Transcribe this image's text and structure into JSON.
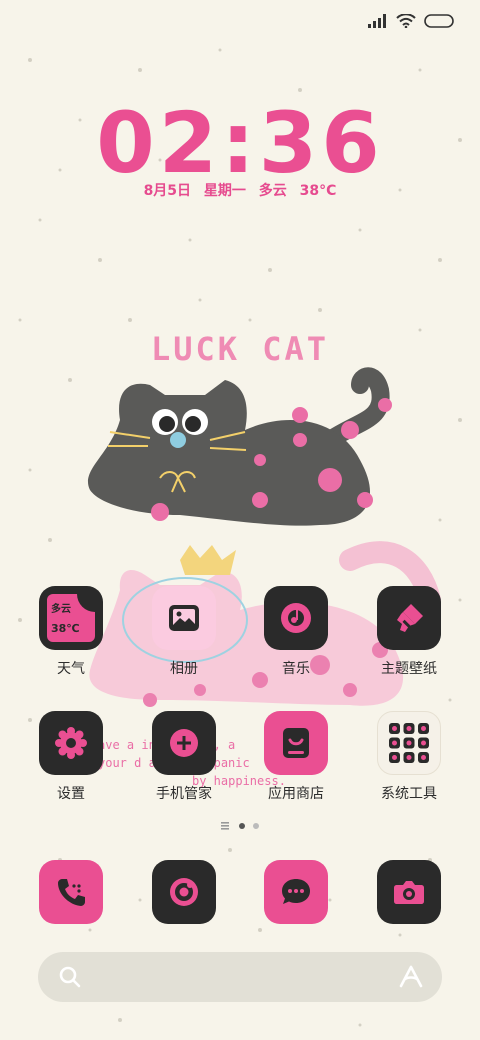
{
  "status_bar": {
    "icons": [
      "signal-icon",
      "wifi-icon",
      "battery-icon"
    ]
  },
  "clock": {
    "time": "02:36"
  },
  "date_line": {
    "date": "8月5日",
    "weekday": "星期一",
    "weather": "多云",
    "temp": "38°C"
  },
  "wallpaper": {
    "title": "LUCK CAT",
    "quote_lines": [
      "ave a       innoc       ife , a",
      "your d     always      ompanic",
      "by happiness."
    ]
  },
  "weather_widget": {
    "condition": "多云",
    "temp": "38℃"
  },
  "apps_row1": [
    {
      "label": "天气",
      "icon": "weather-icon"
    },
    {
      "label": "相册",
      "icon": "gallery-icon"
    },
    {
      "label": "音乐",
      "icon": "music-icon"
    },
    {
      "label": "主题壁纸",
      "icon": "theme-brush-icon"
    }
  ],
  "apps_row2": [
    {
      "label": "设置",
      "icon": "settings-gear-icon"
    },
    {
      "label": "手机管家",
      "icon": "security-plus-icon"
    },
    {
      "label": "应用商店",
      "icon": "app-store-icon"
    },
    {
      "label": "系统工具",
      "icon": "folder-icon"
    }
  ],
  "page_indicator": {
    "pages": 2,
    "current": 1
  },
  "dock": [
    {
      "icon": "phone-icon"
    },
    {
      "icon": "browser-icon"
    },
    {
      "icon": "messages-icon"
    },
    {
      "icon": "camera-icon"
    }
  ],
  "search_bar": {
    "left_icon": "search-icon",
    "right_icon": "assistant-icon"
  },
  "colors": {
    "accent": "#ea4f92",
    "dark_tile": "#2a2a2a",
    "background": "#f7f4ea",
    "soft_pink": "#ffc6dc"
  }
}
